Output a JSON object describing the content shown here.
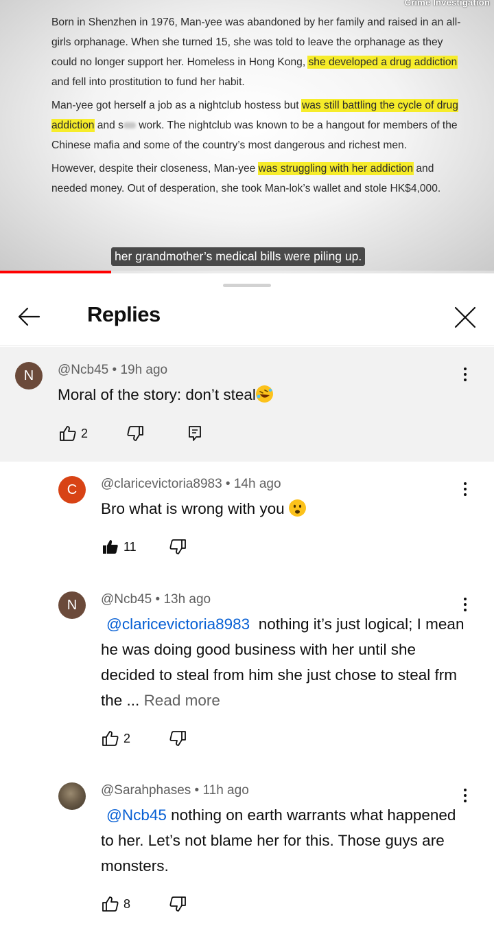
{
  "video": {
    "watermark": "Crime Investigation",
    "paragraphs": [
      [
        {
          "t": "Born in Shenzhen in 1976, Man-yee was abandoned by her family and raised in an all-girls orphanage. When she turned 15, she was told to leave the orphanage as they could no longer support her. Homeless in Hong Kong, "
        },
        {
          "t": "she developed a drug addiction",
          "hl": true
        },
        {
          "t": " and fell into prostitution to fund her habit."
        }
      ],
      [
        {
          "t": "Man-yee got herself a job as a nightclub hostess but "
        },
        {
          "t": "was still battling the cycle of drug addiction",
          "hl": true
        },
        {
          "t": " and s"
        },
        {
          "blur": true
        },
        {
          "t": " work. The nightclub was known to be a hangout for members of the Chinese mafia and some of the country’s most dangerous and richest men."
        }
      ],
      [
        {
          "t": "However, despite their closeness, Man-yee "
        },
        {
          "t": "was struggling with her addiction",
          "hl": true
        },
        {
          "t": " and needed money. Out of desperation, she took Man-lok’s wallet and stole HK$4,000."
        }
      ]
    ],
    "caption": "her grandmother’s medical bills were piling up.",
    "progress_fraction": 0.225,
    "colors": {
      "highlight": "#f6ec2a",
      "progress": "#ff0000"
    }
  },
  "panel": {
    "title": "Replies",
    "back_icon": "arrow-left-icon",
    "close_icon": "close-icon"
  },
  "parent_comment": {
    "avatar_letter": "N",
    "avatar_color": "#6b4a3a",
    "author": "@Ncb45",
    "time": "19h ago",
    "text": "Moral of the story: don’t steal",
    "emoji": "rolling-on-floor-laughing-emoji",
    "likes": "2"
  },
  "replies": [
    {
      "avatar_letter": "C",
      "avatar_color": "#d84315",
      "author": "@claricevictoria8983",
      "time": "14h ago",
      "text": "Bro what is wrong with you",
      "emoji": "frowning-face-emoji",
      "likes": "11",
      "liked": true
    },
    {
      "avatar_letter": "N",
      "avatar_color": "#6b4a3a",
      "author": "@Ncb45",
      "time": "13h ago",
      "mention": "@claricevictoria8983",
      "text": "nothing it’s just logical; I mean he was doing good business with her until she decided to steal from him she just chose to steal frm the ...",
      "read_more": "Read more",
      "likes": "2",
      "liked": false
    },
    {
      "avatar_photo": true,
      "author": "@Sarahphases",
      "time": "11h ago",
      "mention": "@Ncb45",
      "text": "nothing on earth warrants what happened to her. Let’s not blame her for this. Those guys are monsters.",
      "likes": "8",
      "liked": false
    }
  ],
  "separator": "•"
}
